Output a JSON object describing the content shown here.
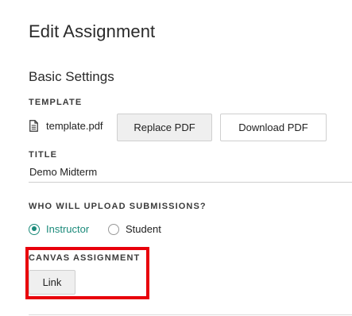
{
  "page": {
    "title": "Edit Assignment"
  },
  "basic_settings": {
    "heading": "Basic Settings"
  },
  "template": {
    "label": "TEMPLATE",
    "file_name": "template.pdf",
    "replace_button": "Replace PDF",
    "download_button": "Download PDF"
  },
  "title_field": {
    "label": "TITLE",
    "value": "Demo Midterm"
  },
  "upload": {
    "label": "WHO WILL UPLOAD SUBMISSIONS?",
    "options": [
      {
        "label": "Instructor",
        "selected": true
      },
      {
        "label": "Student",
        "selected": false
      }
    ]
  },
  "canvas": {
    "label": "CANVAS ASSIGNMENT",
    "link_button": "Link",
    "highlight_color": "#e8000b"
  },
  "colors": {
    "accent": "#1b8a7a",
    "button_gray": "#efefef"
  }
}
